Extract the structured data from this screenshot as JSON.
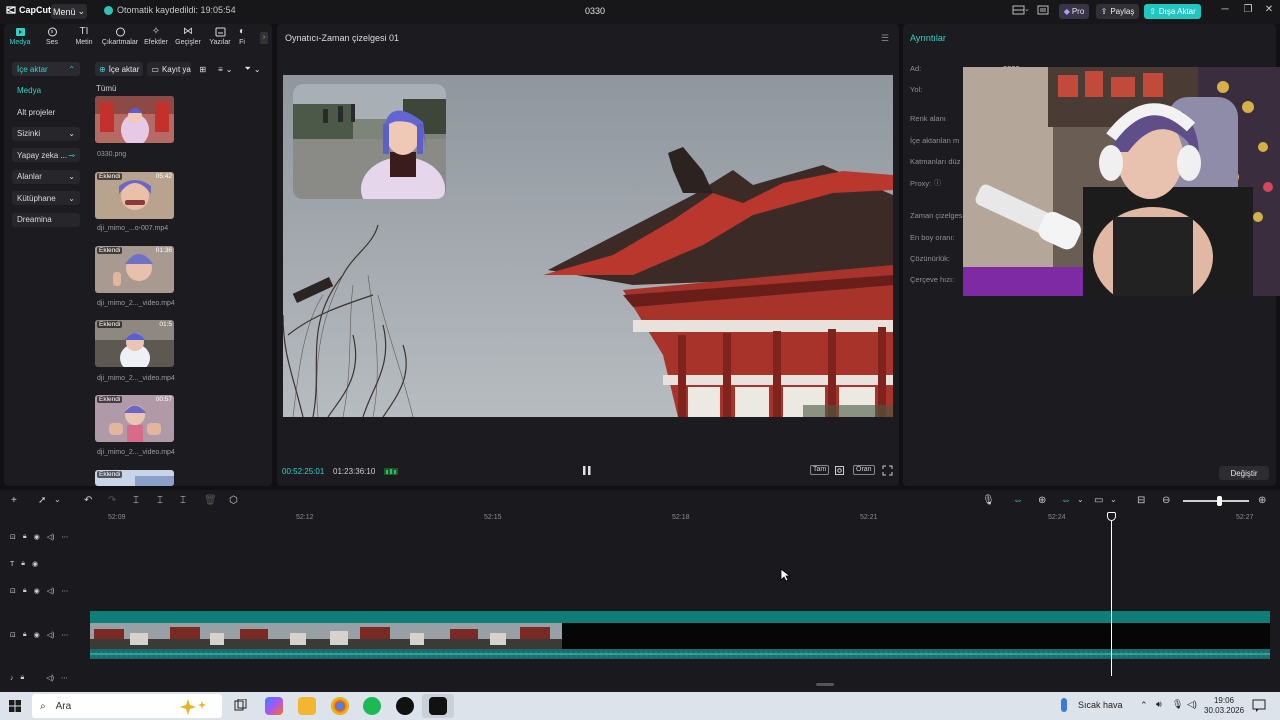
{
  "titlebar": {
    "logo": "CapCut",
    "menu": "Menü",
    "autosave": "Otomatik kaydedildi: 19:05:54",
    "project": "0330",
    "pro": "Pro",
    "share": "Paylaş",
    "export": "Dışa Aktar"
  },
  "tools": [
    {
      "label": "Medya",
      "icon": "media-icon"
    },
    {
      "label": "Ses",
      "icon": "audio-icon"
    },
    {
      "label": "Metin",
      "icon": "text-icon"
    },
    {
      "label": "Çıkartmalar",
      "icon": "sticker-icon"
    },
    {
      "label": "Efektler",
      "icon": "effects-icon"
    },
    {
      "label": "Geçişler",
      "icon": "transitions-icon"
    },
    {
      "label": "Yazılar",
      "icon": "captions-icon"
    },
    {
      "label": "Fi",
      "icon": "filters-icon"
    }
  ],
  "sidebar": [
    "İçe aktar",
    "Medya",
    "Alt projeler",
    "Sizinki",
    "Yapay zeka ...",
    "Alanlar",
    "Kütüphane",
    "Dreamina"
  ],
  "media": {
    "import": "İçe aktar",
    "record": "Kayıt yap",
    "all": "Tümü",
    "items": [
      {
        "name": "0330.png",
        "tag": "",
        "dur": ""
      },
      {
        "name": "dji_mimo_...o-007.mp4",
        "tag": "Eklendi",
        "dur": "05:42"
      },
      {
        "name": "dji_mimo_2..._video.mp4",
        "tag": "Eklendi",
        "dur": "01:36"
      },
      {
        "name": "dji_mimo_2..._video.mp4",
        "tag": "Eklendi",
        "dur": "01:5"
      },
      {
        "name": "dji_mimo_2..._video.mp4",
        "tag": "Eklendi",
        "dur": "00:57"
      },
      {
        "name": "",
        "tag": "Eklendi",
        "dur": ""
      }
    ]
  },
  "player": {
    "title": "Oynatıcı-Zaman çizelgesi 01",
    "current": "00:52:25:01",
    "total": "01:23:36:10",
    "full": "Tam",
    "ratio": "Oran"
  },
  "details": {
    "title": "Ayrıntılar",
    "rows": [
      "Ad:",
      "Yol:",
      "Renk alanı",
      "İçe aktarılan m",
      "Katmanları düz",
      "Proxy:",
      "Zaman çizelges",
      "En boy oranı:",
      "Çözünürlük:",
      "Çerçeve hızı:"
    ],
    "name_value": "0330",
    "change": "Değiştir"
  },
  "timeline": {
    "ticks": [
      "52:09",
      "52:12",
      "52:15",
      "52:18",
      "52:21",
      "52:24",
      "52:27"
    ]
  },
  "taskbar": {
    "search": "Ara",
    "weather": "Sıcak hava",
    "time": "19:06",
    "date": "30.03.2026"
  },
  "colors": {
    "accent": "#2ed3c8",
    "track": "#0f7d78"
  }
}
